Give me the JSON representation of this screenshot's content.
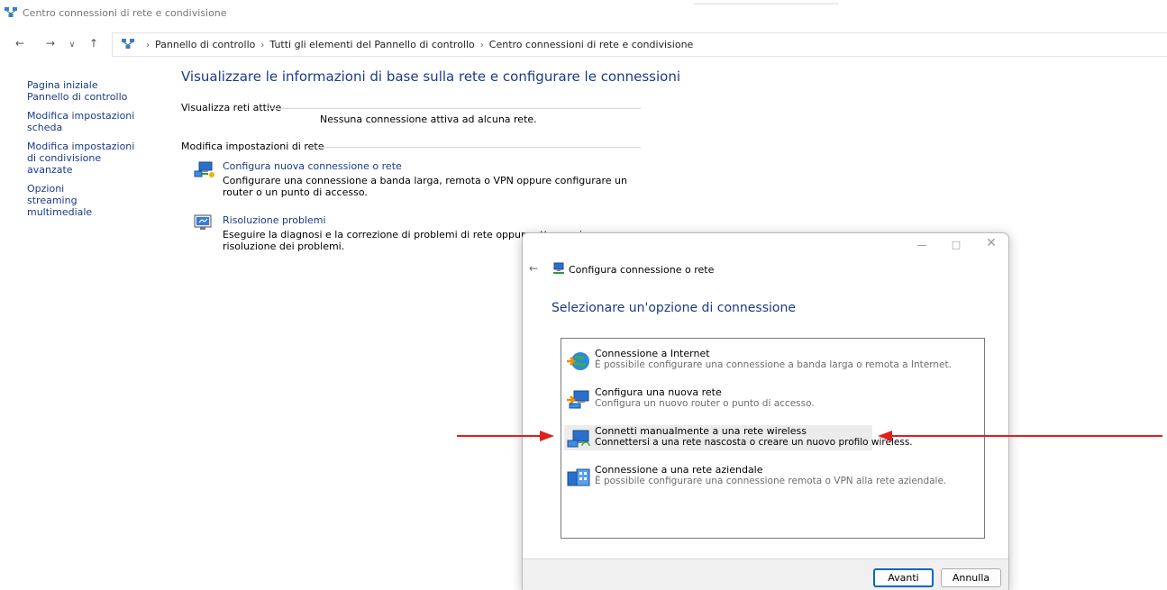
{
  "window": {
    "title": "Centro connessioni di rete e condivisione"
  },
  "nav": {
    "back_icon": "arrow-left-icon",
    "forward_icon": "arrow-right-icon",
    "recent_icon": "chevron-down-icon",
    "up_icon": "arrow-up-icon",
    "breadcrumbs": [
      "Pannello di controllo",
      "Tutti gli elementi del Pannello di controllo",
      "Centro connessioni di rete e condivisione"
    ]
  },
  "sidebar": {
    "items": [
      {
        "label": "Pagina iniziale Pannello di controllo"
      },
      {
        "label": "Modifica impostazioni scheda"
      },
      {
        "label": "Modifica impostazioni di condivisione avanzate"
      },
      {
        "label": "Opzioni streaming multimediale"
      }
    ]
  },
  "main": {
    "title": "Visualizzare le informazioni di base sulla rete e configurare le connessioni",
    "active_networks_label": "Visualizza reti attive",
    "no_connection": "Nessuna connessione attiva ad alcuna rete.",
    "change_settings_label": "Modifica impostazioni di rete",
    "tasks": [
      {
        "link": "Configura nuova connessione o rete",
        "desc": "Configurare una connessione a banda larga, remota o VPN oppure configurare un router o un punto di accesso.",
        "icon": "network-setup-icon"
      },
      {
        "link": "Risoluzione problemi",
        "desc": "Eseguire la diagnosi e la correzione di problemi di rete oppure ottenere i",
        "desc2": "risoluzione dei problemi.",
        "icon": "troubleshoot-icon"
      }
    ]
  },
  "dialog": {
    "title": "Configura connessione o rete",
    "heading": "Selezionare un'opzione di connessione",
    "options": [
      {
        "name": "Connessione a Internet",
        "desc": "È possibile configurare una connessione a banda larga o remota a Internet.",
        "icon": "globe-icon",
        "selected": false
      },
      {
        "name": "Configura una nuova rete",
        "desc": "Configura un nuovo router o punto di accesso.",
        "icon": "new-network-icon",
        "selected": false
      },
      {
        "name": "Connetti manualmente a una rete wireless",
        "desc": "Connettersi a una rete nascosta o creare un nuovo profilo wireless.",
        "icon": "wireless-icon",
        "selected": true
      },
      {
        "name": "Connessione a una rete aziendale",
        "desc": "È possibile configurare una connessione remota o VPN alla rete aziendale.",
        "icon": "workplace-icon",
        "selected": false
      }
    ],
    "next_label": "Avanti",
    "cancel_label": "Annulla"
  },
  "colors": {
    "link": "#1a3a8a",
    "annotation_arrow": "#e02020",
    "primary_border": "#0067c0"
  }
}
